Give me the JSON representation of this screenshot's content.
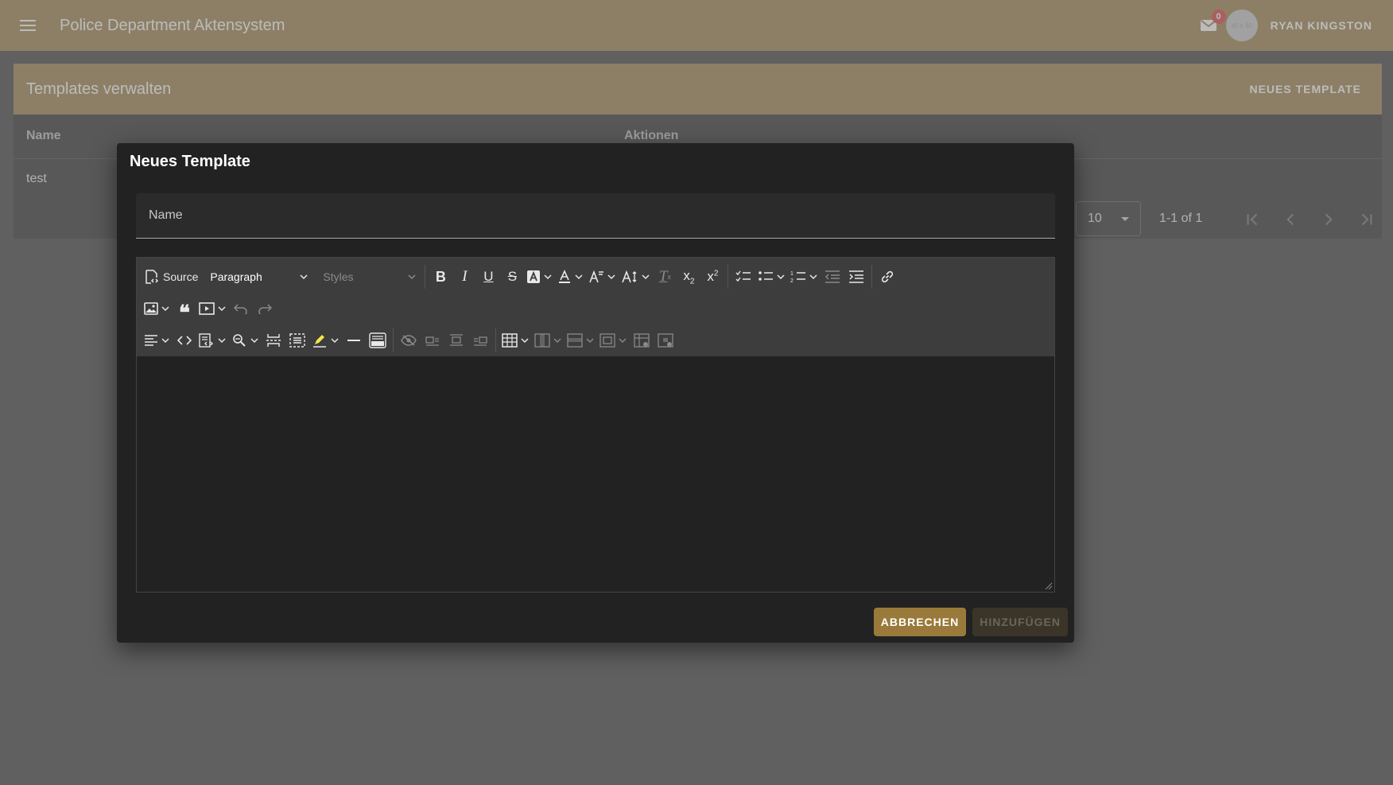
{
  "app": {
    "title": "Police Department Aktensystem",
    "mail_count": "0",
    "avatar_text": "40 x 40",
    "user_name": "RYAN KINGSTON"
  },
  "page": {
    "title": "Templates verwalten",
    "new_button": "NEUES TEMPLATE",
    "columns": [
      "Name",
      "Aktionen"
    ],
    "rows": [
      {
        "name": "test"
      }
    ],
    "per_page": "10",
    "range": "1-1 of 1"
  },
  "dialog": {
    "title": "Neues Template",
    "name_label": "Name",
    "toolbar": {
      "source": "Source",
      "heading": "Paragraph",
      "styles": "Styles"
    },
    "cancel": "ABBRECHEN",
    "add": "HINZUFÜGEN"
  },
  "colors": {
    "brand": "#b9a47b",
    "dialog_bg": "#222222",
    "cancel_btn": "#9a7a3a"
  }
}
